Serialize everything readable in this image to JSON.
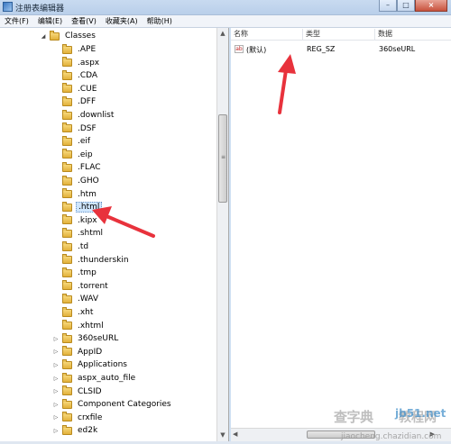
{
  "window": {
    "title": "注册表编辑器",
    "min": "–",
    "max": "□",
    "close": "×"
  },
  "menu": [
    "文件(F)",
    "编辑(E)",
    "查看(V)",
    "收藏夹(A)",
    "帮助(H)"
  ],
  "tree": {
    "root": "Classes",
    "items": [
      {
        "label": ".APE",
        "expander": ""
      },
      {
        "label": ".aspx",
        "expander": ""
      },
      {
        "label": ".CDA",
        "expander": ""
      },
      {
        "label": ".CUE",
        "expander": ""
      },
      {
        "label": ".DFF",
        "expander": ""
      },
      {
        "label": ".downlist",
        "expander": ""
      },
      {
        "label": ".DSF",
        "expander": ""
      },
      {
        "label": ".eif",
        "expander": ""
      },
      {
        "label": ".eip",
        "expander": ""
      },
      {
        "label": ".FLAC",
        "expander": ""
      },
      {
        "label": ".GHO",
        "expander": ""
      },
      {
        "label": ".htm",
        "expander": ""
      },
      {
        "label": ".html",
        "expander": "",
        "selected": true
      },
      {
        "label": ".kipx",
        "expander": ""
      },
      {
        "label": ".shtml",
        "expander": ""
      },
      {
        "label": ".td",
        "expander": ""
      },
      {
        "label": ".thunderskin",
        "expander": ""
      },
      {
        "label": ".tmp",
        "expander": ""
      },
      {
        "label": ".torrent",
        "expander": ""
      },
      {
        "label": ".WAV",
        "expander": ""
      },
      {
        "label": ".xht",
        "expander": ""
      },
      {
        "label": ".xhtml",
        "expander": ""
      },
      {
        "label": "360seURL",
        "expander": "▷"
      },
      {
        "label": "AppID",
        "expander": "▷"
      },
      {
        "label": "Applications",
        "expander": "▷"
      },
      {
        "label": "aspx_auto_file",
        "expander": "▷"
      },
      {
        "label": "CLSID",
        "expander": "▷"
      },
      {
        "label": "Component Categories",
        "expander": "▷"
      },
      {
        "label": "crxfile",
        "expander": "▷"
      },
      {
        "label": "ed2k",
        "expander": "▷"
      }
    ]
  },
  "values": {
    "columns": [
      "名称",
      "类型",
      "数据"
    ],
    "rows": [
      {
        "icon": "ab",
        "name": "(默认)",
        "type": "REG_SZ",
        "data": "360seURL"
      }
    ]
  },
  "scroll": {
    "grip": "≡",
    "up": "▲",
    "down": "▼",
    "left": "◀",
    "right": "▶"
  },
  "watermark": {
    "line1": "查字典",
    "line2": "教程网",
    "site": "jiaocheng.chazidian.com",
    "badge": "jb51.net"
  },
  "colors": {
    "arrow": "#e8323c",
    "selection": "#cfe6fc"
  }
}
